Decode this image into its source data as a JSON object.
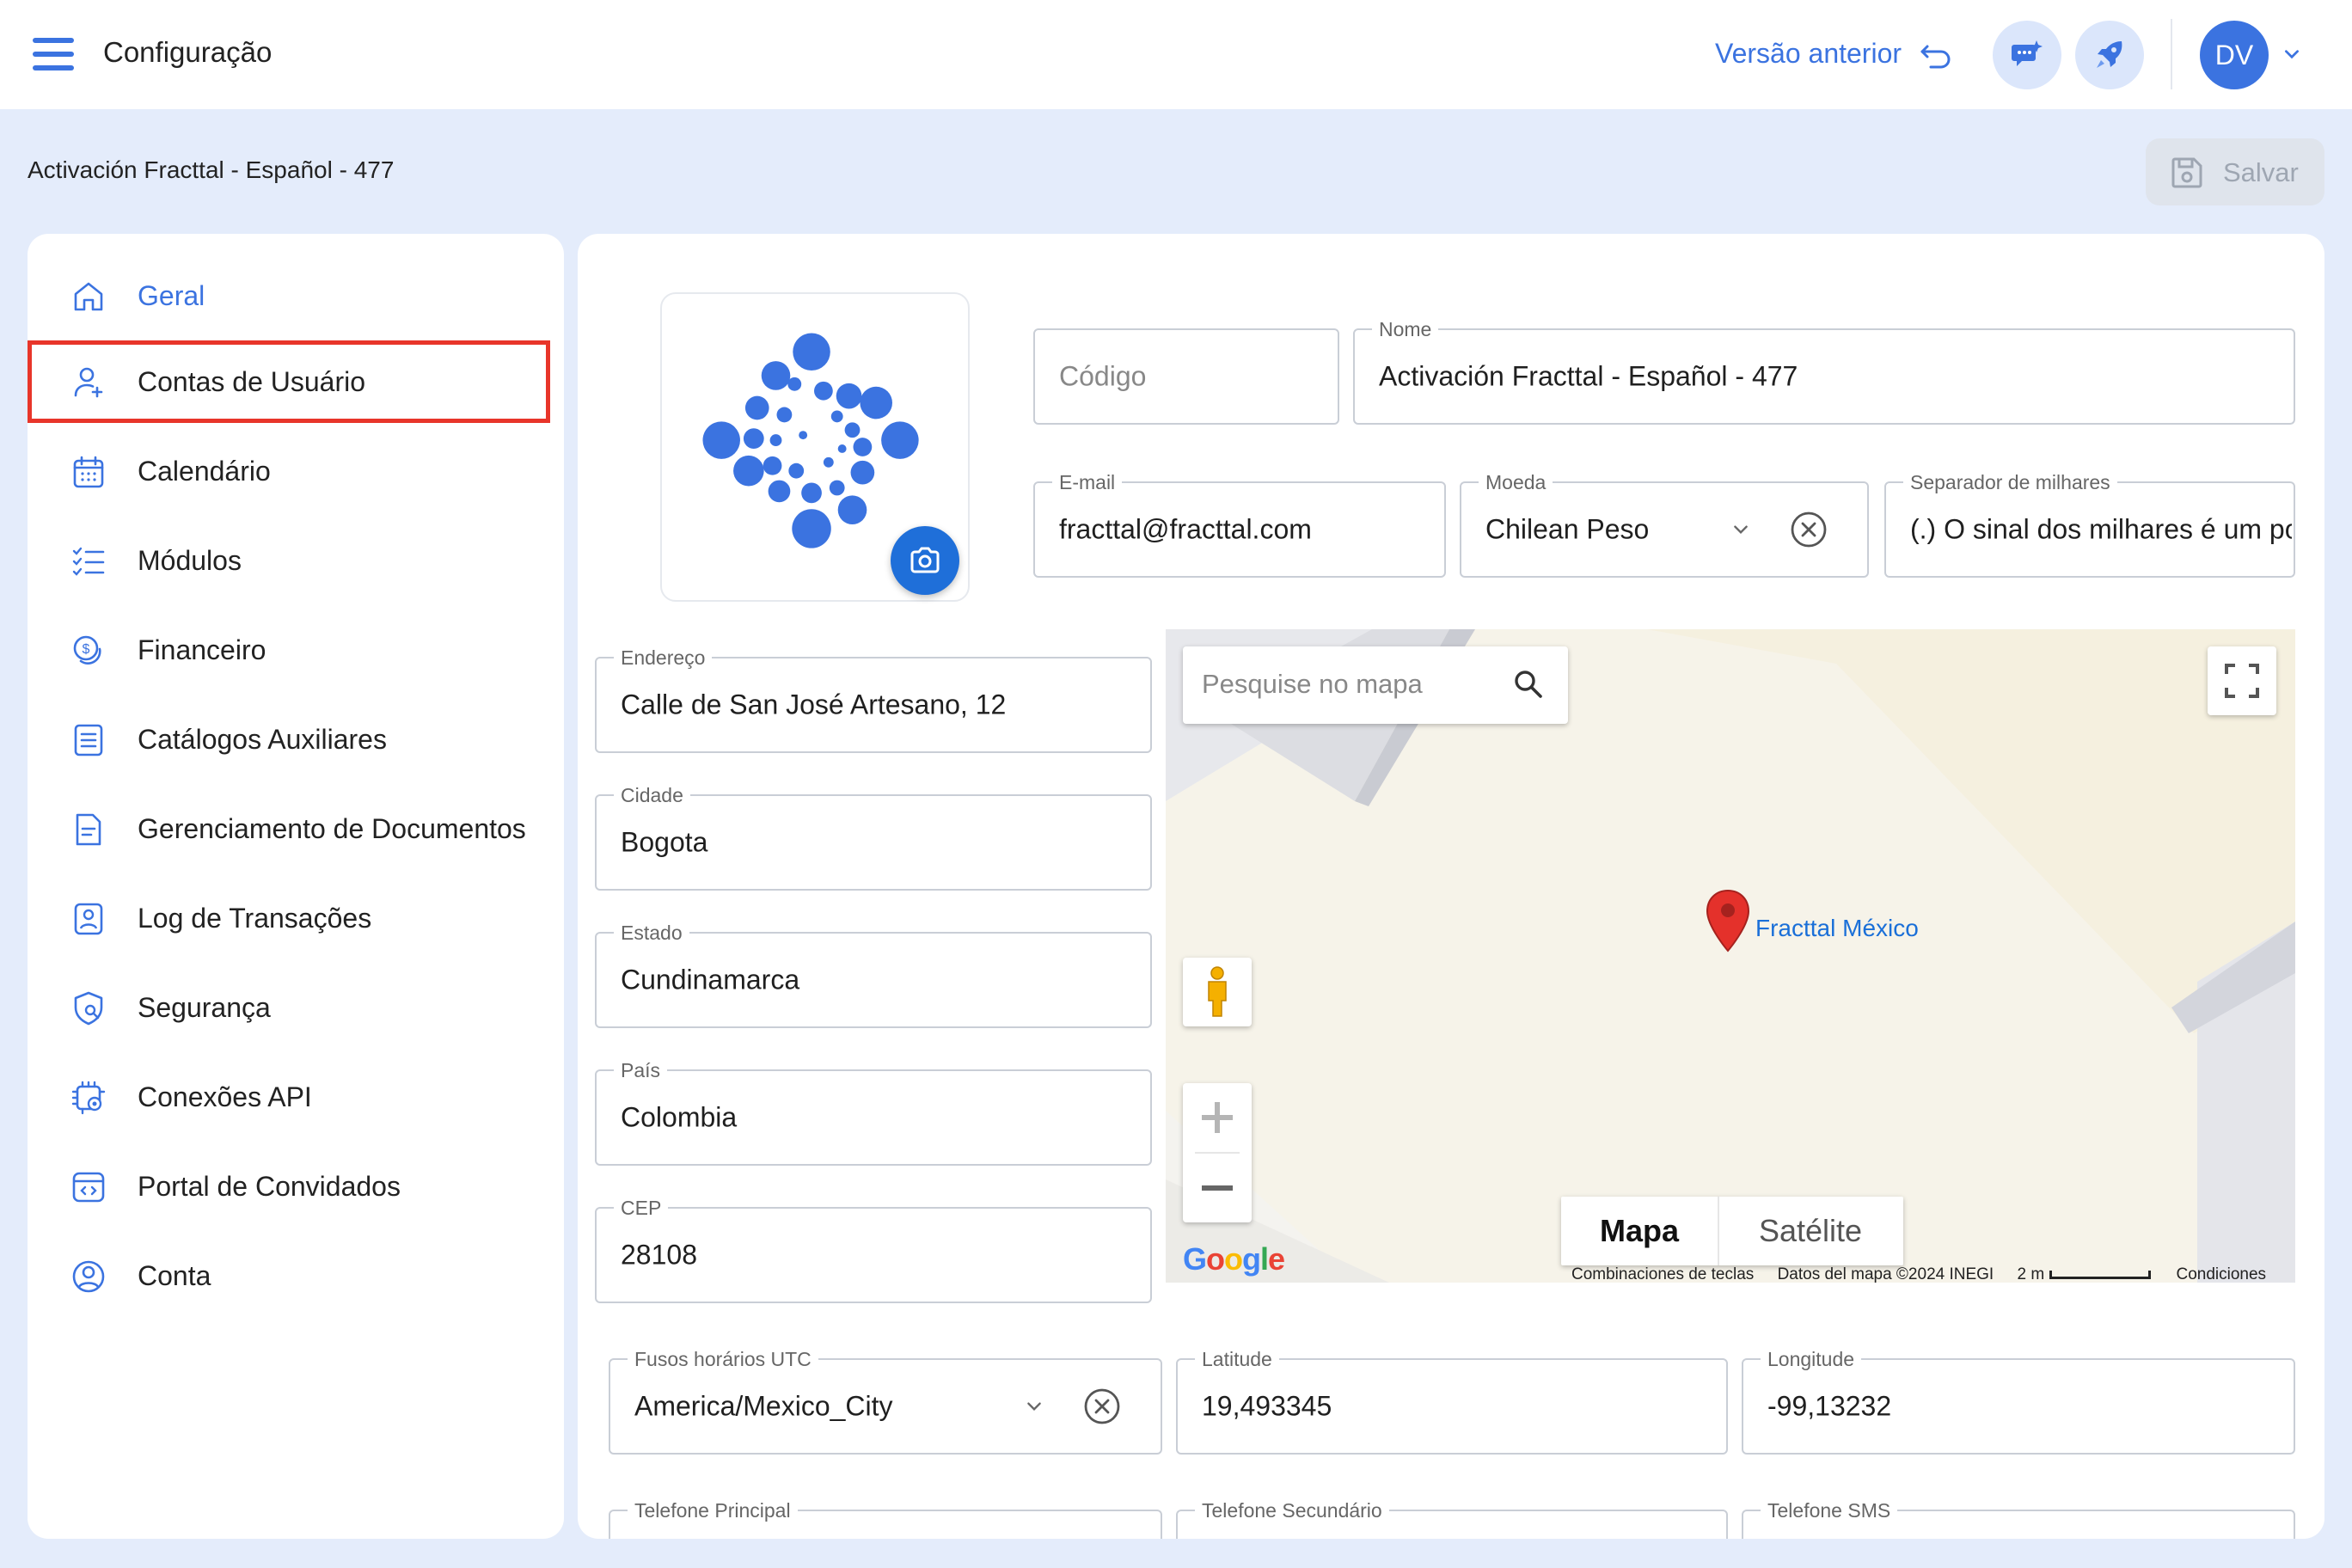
{
  "header": {
    "title": "Configuração",
    "previous_version": "Versão anterior",
    "avatar_initials": "DV"
  },
  "subheader": {
    "page_name": "Activación Fracttal - Español - 477",
    "save_label": "Salvar"
  },
  "sidebar": {
    "items": [
      {
        "label": "Geral",
        "icon": "home-icon",
        "active": true
      },
      {
        "label": "Contas de Usuário",
        "icon": "user-add-icon",
        "highlighted": true
      },
      {
        "label": "Calendário",
        "icon": "calendar-icon"
      },
      {
        "label": "Módulos",
        "icon": "checklist-icon"
      },
      {
        "label": "Financeiro",
        "icon": "money-icon"
      },
      {
        "label": "Catálogos Auxiliares",
        "icon": "catalog-icon"
      },
      {
        "label": "Gerenciamento de Documentos",
        "icon": "document-icon"
      },
      {
        "label": "Log de Transações",
        "icon": "log-icon"
      },
      {
        "label": "Segurança",
        "icon": "security-icon"
      },
      {
        "label": "Conexões API",
        "icon": "api-gear-icon"
      },
      {
        "label": "Portal de Convidados",
        "icon": "portal-icon"
      },
      {
        "label": "Conta",
        "icon": "account-icon"
      }
    ]
  },
  "form": {
    "codigo": {
      "placeholder": "Código",
      "value": ""
    },
    "nome": {
      "label": "Nome",
      "value": "Activación Fracttal - Español - 477"
    },
    "email": {
      "label": "E-mail",
      "value": "fracttal@fracttal.com"
    },
    "moeda": {
      "label": "Moeda",
      "value": "Chilean Peso"
    },
    "separador": {
      "label": "Separador de milhares",
      "value": "(.) O sinal dos milhares é um ponto"
    },
    "endereco": {
      "label": "Endereço",
      "value": "Calle de San José Artesano, 12"
    },
    "cidade": {
      "label": "Cidade",
      "value": "Bogota"
    },
    "estado": {
      "label": "Estado",
      "value": "Cundinamarca"
    },
    "pais": {
      "label": "País",
      "value": "Colombia"
    },
    "cep": {
      "label": "CEP",
      "value": "28108"
    },
    "fuso": {
      "label": "Fusos horários UTC",
      "value": "America/Mexico_City"
    },
    "latitude": {
      "label": "Latitude",
      "value": "19,493345"
    },
    "longitude": {
      "label": "Longitude",
      "value": "-99,13232"
    },
    "tel_principal": {
      "label": "Telefone Principal",
      "value": ""
    },
    "tel_secundario": {
      "label": "Telefone Secundário",
      "value": ""
    },
    "tel_sms": {
      "label": "Telefone SMS",
      "value": ""
    }
  },
  "map": {
    "search_placeholder": "Pesquise no mapa",
    "pin_label": "Fracttal México",
    "type_map": "Mapa",
    "type_satellite": "Satélite",
    "footer_shortcuts": "Combinaciones de teclas",
    "footer_data": "Datos del mapa ©2024 INEGI",
    "footer_scale": "2 m",
    "footer_terms": "Condiciones",
    "logo": "Google"
  },
  "colors": {
    "accent": "#3b73e0",
    "highlight_border": "#e8352a",
    "background": "#e4ecfb",
    "camera_button": "#1f6fd9"
  }
}
